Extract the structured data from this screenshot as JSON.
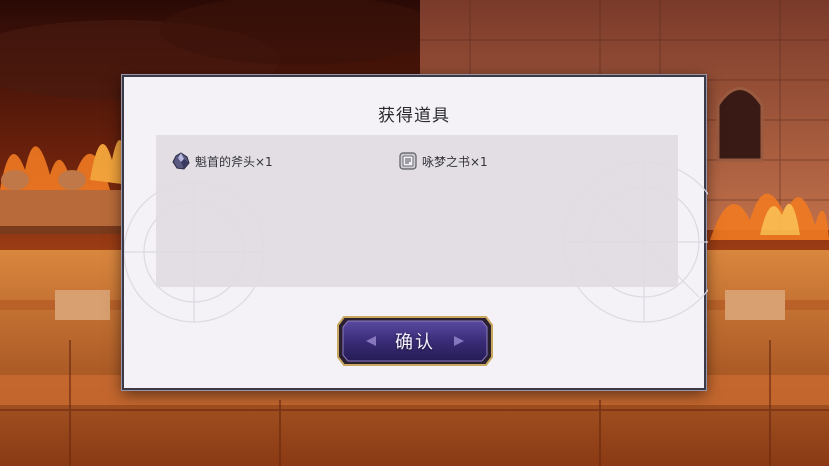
{
  "dialog": {
    "title": "获得道具",
    "confirm_label": "确认"
  },
  "items": [
    {
      "name": "魁首的斧头×1",
      "icon": "crystal-ore-icon"
    },
    {
      "name": "咏梦之书×1",
      "icon": "dream-book-icon"
    }
  ],
  "colors": {
    "panel_bg": "#f4f2f6",
    "items_bg": "#e0dce2",
    "button_purple": "#3d2f78",
    "button_gold": "#c9a860",
    "fire": "#e85a1a"
  }
}
